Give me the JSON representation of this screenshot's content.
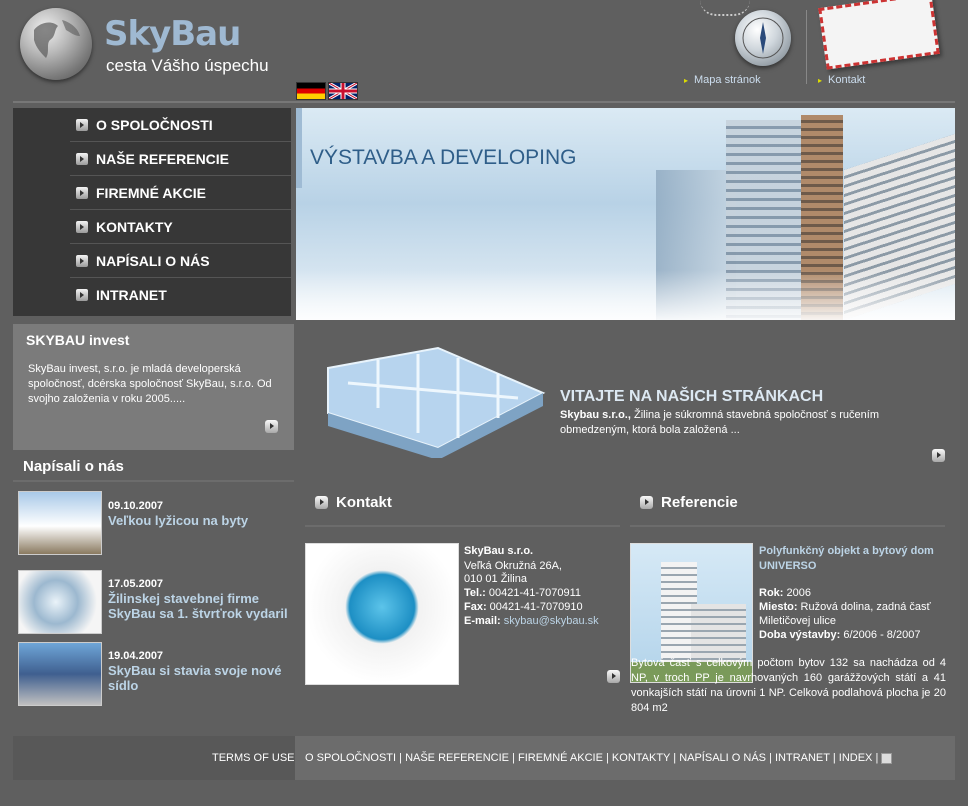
{
  "header": {
    "logo_title": "SkyBau",
    "logo_subtitle": "cesta Vášho úspechu",
    "links": {
      "sitemap": "Mapa stránok",
      "contact": "Kontakt"
    }
  },
  "menu": {
    "items": [
      {
        "label": "O SPOLOČNOSTI"
      },
      {
        "label": "NAŠE REFERENCIE"
      },
      {
        "label": "FIREMNÉ AKCIE"
      },
      {
        "label": "KONTAKTY"
      },
      {
        "label": "NAPÍSALI O NÁS"
      },
      {
        "label": "INTRANET"
      }
    ]
  },
  "banner": {
    "title": "VÝSTAVBA A DEVELOPING"
  },
  "invest": {
    "title": "SKYBAU invest",
    "text": "SkyBau invest, s.r.o. je mladá developerská spoločnosť, dcérska spoločnosť SkyBau, s.r.o.  Od svojho založenia v roku 2005....."
  },
  "news": {
    "title": "Napísali o nás",
    "items": [
      {
        "date": "09.10.2007",
        "text": "Veľkou lyžicou na byty"
      },
      {
        "date": "17.05.2007",
        "text": "Žilinskej stavebnej firme SkyBau sa 1. štvrťrok vydaril"
      },
      {
        "date": "19.04.2007",
        "text": " SkyBau si stavia svoje nové sídlo"
      }
    ]
  },
  "welcome": {
    "title": "VITAJTE NA NAŠICH STRÁNKACH",
    "lead": "Skybau s.r.o.,",
    "text": " Žilina je súkromná stavebná spoločnosť s ručením obmedzeným, ktorá bola založená ..."
  },
  "contact": {
    "title": "Kontakt",
    "company": "SkyBau s.r.o.",
    "street": "Veľká Okružná 26A,",
    "city": "010 01 Žilina",
    "tel_label": "Tel.:",
    "tel": " 00421-41-7070911",
    "fax_label": "Fax:",
    "fax": " 00421-41-7070910",
    "email_label": "E-mail:",
    "email": " skybau@skybau.sk"
  },
  "references": {
    "title": "Referencie",
    "project": "Polyfunkčný objekt a bytový dom UNIVERSO",
    "year_label": "Rok:",
    "year": " 2006",
    "place_label": "Miesto:",
    "place": " Ružová dolina, zadná časť Miletičovej ulice",
    "duration_label": "Doba výstavby:",
    "duration": " 6/2006 - 8/2007",
    "body": "Bytová časť s celkovým počtom bytov 132 sa nachádza od 4 NP, v troch PP je navrhovaných 160 garážžových státí a 41 vonkajších státí na úrovni 1 NP. Celková podlahová plocha je 20 804 m2"
  },
  "footer": {
    "terms": "TERMS OF USE",
    "links": [
      "O SPOLOČNOSTI",
      "NAŠE REFERENCIE",
      "FIREMNÉ AKCIE",
      "KONTAKTY",
      "NAPÍSALI O NÁS",
      "INTRANET",
      "INDEX"
    ],
    "separator": " | "
  }
}
